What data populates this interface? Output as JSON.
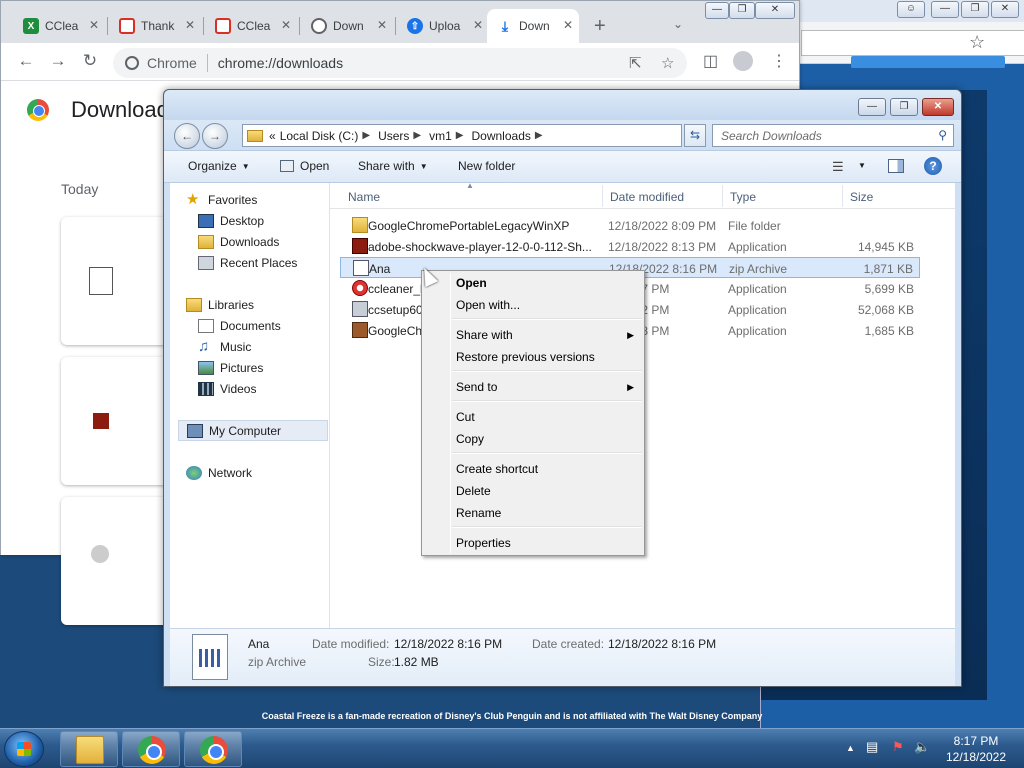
{
  "background_browser": {
    "footer_note": "Coastal Freeze is a fan-made recreation of Disney's Club Penguin and is not affiliated with The Walt Disney Company"
  },
  "chrome": {
    "tabs": [
      {
        "label": "CClea",
        "icon": "spreadsheet-icon",
        "color": "#1e8e3e"
      },
      {
        "label": "Thank",
        "icon": "ccleaner-icon",
        "color": "#d93025"
      },
      {
        "label": "CClea",
        "icon": "ccleaner-icon",
        "color": "#d93025"
      },
      {
        "label": "Down",
        "icon": "globe-icon",
        "color": "#5f6368"
      },
      {
        "label": "Uploa",
        "icon": "upload-icon",
        "color": "#1a73e8"
      },
      {
        "label": "Down",
        "icon": "download-icon",
        "color": "#1a73e8"
      }
    ],
    "omnibox_chip": "Chrome",
    "url": "chrome://downloads",
    "page_title": "Downloads",
    "today_label": "Today"
  },
  "explorer": {
    "breadcrumb": [
      "«",
      "Local Disk (C:)",
      "Users",
      "vm1",
      "Downloads"
    ],
    "search_placeholder": "Search Downloads",
    "commands": {
      "organize": "Organize",
      "open": "Open",
      "share_with": "Share with",
      "new_folder": "New folder"
    },
    "nav": {
      "favorites": "Favorites",
      "desktop": "Desktop",
      "downloads": "Downloads",
      "recent_places": "Recent Places",
      "libraries": "Libraries",
      "documents": "Documents",
      "music": "Music",
      "pictures": "Pictures",
      "videos": "Videos",
      "my_computer": "My Computer",
      "network": "Network"
    },
    "columns": {
      "name": "Name",
      "date_modified": "Date modified",
      "type": "Type",
      "size": "Size"
    },
    "files": [
      {
        "name": "GoogleChromePortableLegacyWinXP",
        "date": "12/18/2022 8:09 PM",
        "type": "File folder",
        "size": ""
      },
      {
        "name": "adobe-shockwave-player-12-0-0-112-Sh...",
        "date": "12/18/2022 8:13 PM",
        "type": "Application",
        "size": "14,945 KB"
      },
      {
        "name": "Ana",
        "date": "12/18/2022 8:16 PM",
        "type": "zip Archive",
        "size": "1,871 KB"
      },
      {
        "name": "ccleaner_l",
        "date": "22 7:27 PM",
        "type": "Application",
        "size": "5,699 KB"
      },
      {
        "name": "ccsetup60",
        "date": "22 7:02 PM",
        "type": "Application",
        "size": "52,068 KB"
      },
      {
        "name": "GoogleCh",
        "date": "22 8:08 PM",
        "type": "Application",
        "size": "1,685 KB"
      }
    ],
    "details": {
      "name": "Ana",
      "type": "zip Archive",
      "date_modified_label": "Date modified:",
      "date_modified": "12/18/2022 8:16 PM",
      "date_created_label": "Date created:",
      "date_created": "12/18/2022 8:16 PM",
      "size_label": "Size:",
      "size": "1.82 MB"
    }
  },
  "context_menu": {
    "open": "Open",
    "open_with": "Open with...",
    "share_with": "Share with",
    "restore": "Restore previous versions",
    "send_to": "Send to",
    "cut": "Cut",
    "copy": "Copy",
    "create_shortcut": "Create shortcut",
    "delete": "Delete",
    "rename": "Rename",
    "properties": "Properties"
  },
  "taskbar": {
    "time": "8:17 PM",
    "date": "12/18/2022"
  }
}
